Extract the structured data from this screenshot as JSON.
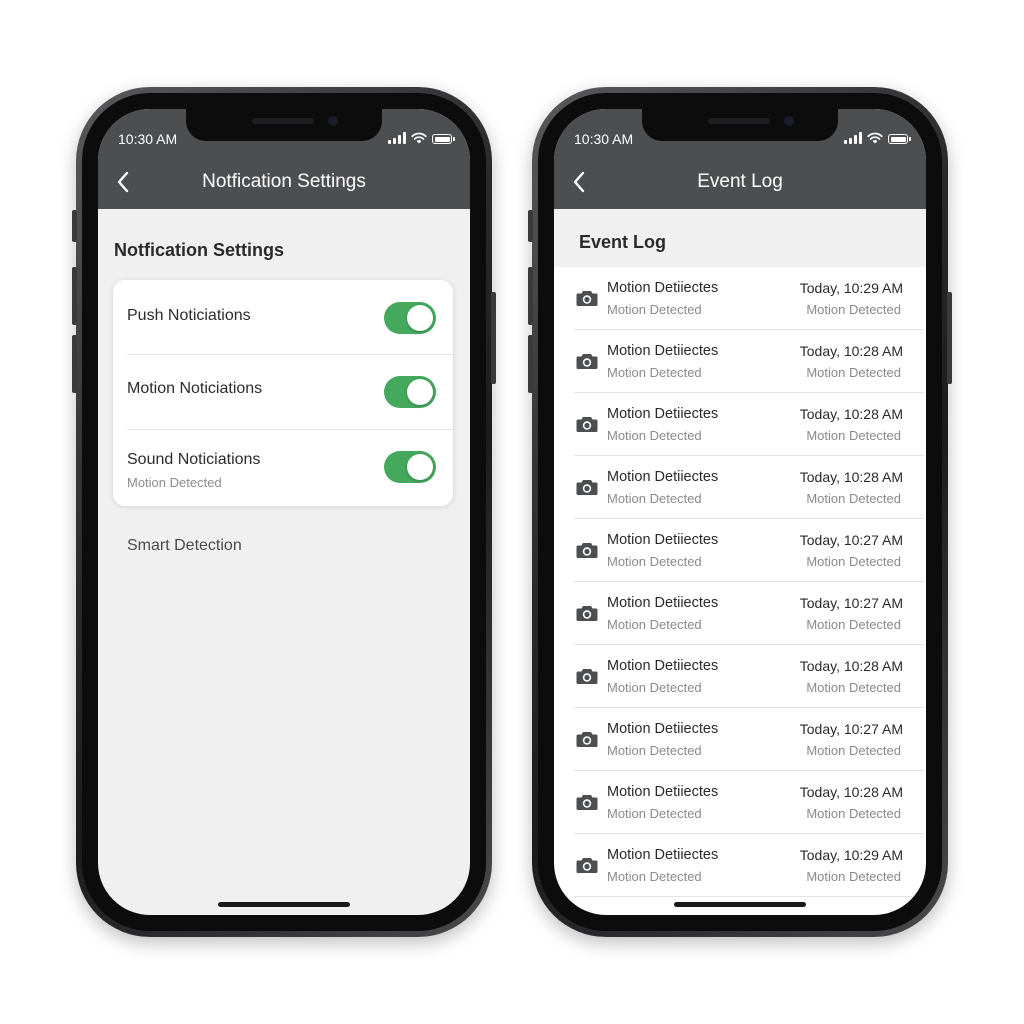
{
  "status_bar": {
    "time": "10:30 AM"
  },
  "left_screen": {
    "nav_title": "Notfication Settings",
    "section_heading": "Notfication Settings",
    "settings": [
      {
        "label": "Push Noticiations",
        "sublabel": "",
        "enabled": true
      },
      {
        "label": "Motion Noticiations",
        "sublabel": "",
        "enabled": true
      },
      {
        "label": "Sound Noticiations",
        "sublabel": "Motion Detected",
        "enabled": true
      }
    ],
    "smart_detection": "Smart Detection"
  },
  "right_screen": {
    "nav_title": "Event Log",
    "section_heading": "Event Log",
    "events": [
      {
        "title": "Motion Detiiectes",
        "subtitle": "Motion Detected",
        "time": "Today, 10:29 AM",
        "time_sub": "Motion Detected"
      },
      {
        "title": "Motion Detiiectes",
        "subtitle": "Motion Detected",
        "time": "Today, 10:28 AM",
        "time_sub": "Motion Detected"
      },
      {
        "title": "Motion Detiiectes",
        "subtitle": "Motion Detected",
        "time": "Today, 10:28 AM",
        "time_sub": "Motion Detected"
      },
      {
        "title": "Motion Detiiectes",
        "subtitle": "Motion Detected",
        "time": "Today, 10:28 AM",
        "time_sub": "Motion Detected"
      },
      {
        "title": "Motion Detiiectes",
        "subtitle": "Motion Detected",
        "time": "Today, 10:27 AM",
        "time_sub": "Motion Detected"
      },
      {
        "title": "Motion Detiiectes",
        "subtitle": "Motion Detected",
        "time": "Today, 10:27 AM",
        "time_sub": "Motion Detected"
      },
      {
        "title": "Motion Detiiectes",
        "subtitle": "Motion Detected",
        "time": "Today, 10:28 AM",
        "time_sub": "Motion Detected"
      },
      {
        "title": "Motion Detiiectes",
        "subtitle": "Motion Detected",
        "time": "Today, 10:27 AM",
        "time_sub": "Motion Detected"
      },
      {
        "title": "Motion Detiiectes",
        "subtitle": "Motion Detected",
        "time": "Today, 10:28 AM",
        "time_sub": "Motion Detected"
      },
      {
        "title": "Motion Detiiectes",
        "subtitle": "Motion Detected",
        "time": "Today, 10:29 AM",
        "time_sub": "Motion Detected"
      }
    ]
  },
  "icons": {
    "back": "chevron-left-icon",
    "signal": "cellular-signal-icon",
    "wifi": "wifi-icon",
    "battery": "battery-icon",
    "event": "camera-icon"
  },
  "colors": {
    "header": "#4d4e50",
    "toggle_on": "#45a95d",
    "screen_bg": "#f0f0f0"
  }
}
